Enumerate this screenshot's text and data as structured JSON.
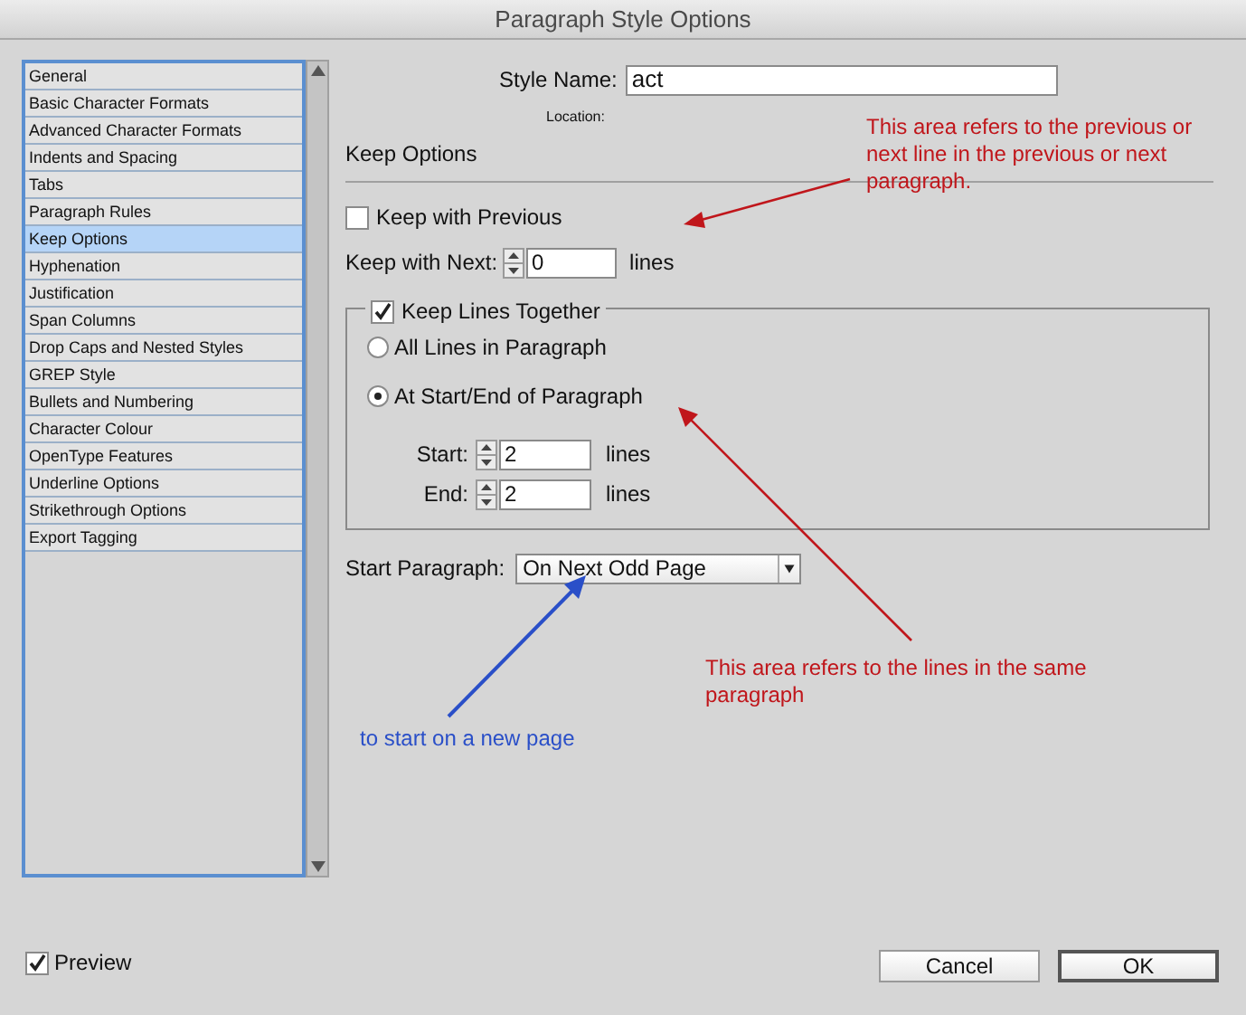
{
  "window": {
    "title": "Paragraph Style Options"
  },
  "sidebar": {
    "items": [
      {
        "label": "General",
        "selected": false
      },
      {
        "label": "Basic Character Formats",
        "selected": false
      },
      {
        "label": "Advanced Character Formats",
        "selected": false
      },
      {
        "label": "Indents and Spacing",
        "selected": false
      },
      {
        "label": "Tabs",
        "selected": false
      },
      {
        "label": "Paragraph Rules",
        "selected": false
      },
      {
        "label": "Keep Options",
        "selected": true
      },
      {
        "label": "Hyphenation",
        "selected": false
      },
      {
        "label": "Justification",
        "selected": false
      },
      {
        "label": "Span Columns",
        "selected": false
      },
      {
        "label": "Drop Caps and Nested Styles",
        "selected": false
      },
      {
        "label": "GREP Style",
        "selected": false
      },
      {
        "label": "Bullets and Numbering",
        "selected": false
      },
      {
        "label": "Character Colour",
        "selected": false
      },
      {
        "label": "OpenType Features",
        "selected": false
      },
      {
        "label": "Underline Options",
        "selected": false
      },
      {
        "label": "Strikethrough Options",
        "selected": false
      },
      {
        "label": "Export Tagging",
        "selected": false
      }
    ]
  },
  "style_name": {
    "label": "Style Name:",
    "value": "act"
  },
  "location": {
    "label": "Location:"
  },
  "section_title": "Keep Options",
  "keep_with_previous": {
    "label": "Keep with Previous",
    "checked": false
  },
  "keep_with_next": {
    "label": "Keep with Next:",
    "value": "0",
    "unit": "lines"
  },
  "keep_lines_together": {
    "label": "Keep Lines Together",
    "checked": true,
    "options": [
      {
        "label": "All Lines in Paragraph",
        "selected": false
      },
      {
        "label": "At Start/End of Paragraph",
        "selected": true
      }
    ],
    "fields": [
      {
        "label": "Start:",
        "value": "2",
        "unit": "lines"
      },
      {
        "label": "End:",
        "value": "2",
        "unit": "lines"
      }
    ]
  },
  "start_paragraph": {
    "label": "Start Paragraph:",
    "value": "On Next Odd Page"
  },
  "preview": {
    "label": "Preview",
    "checked": true
  },
  "buttons": [
    {
      "label": "Cancel",
      "default": false
    },
    {
      "label": "OK",
      "default": true
    }
  ],
  "annotations": [
    {
      "text": "This area refers to the previous or next line in the previous or next paragraph.",
      "color": "#c0161b"
    },
    {
      "text": "This area refers to the lines in the same paragraph",
      "color": "#c0161b"
    },
    {
      "text": "to start on a new page",
      "color": "#2a4fc8"
    }
  ]
}
